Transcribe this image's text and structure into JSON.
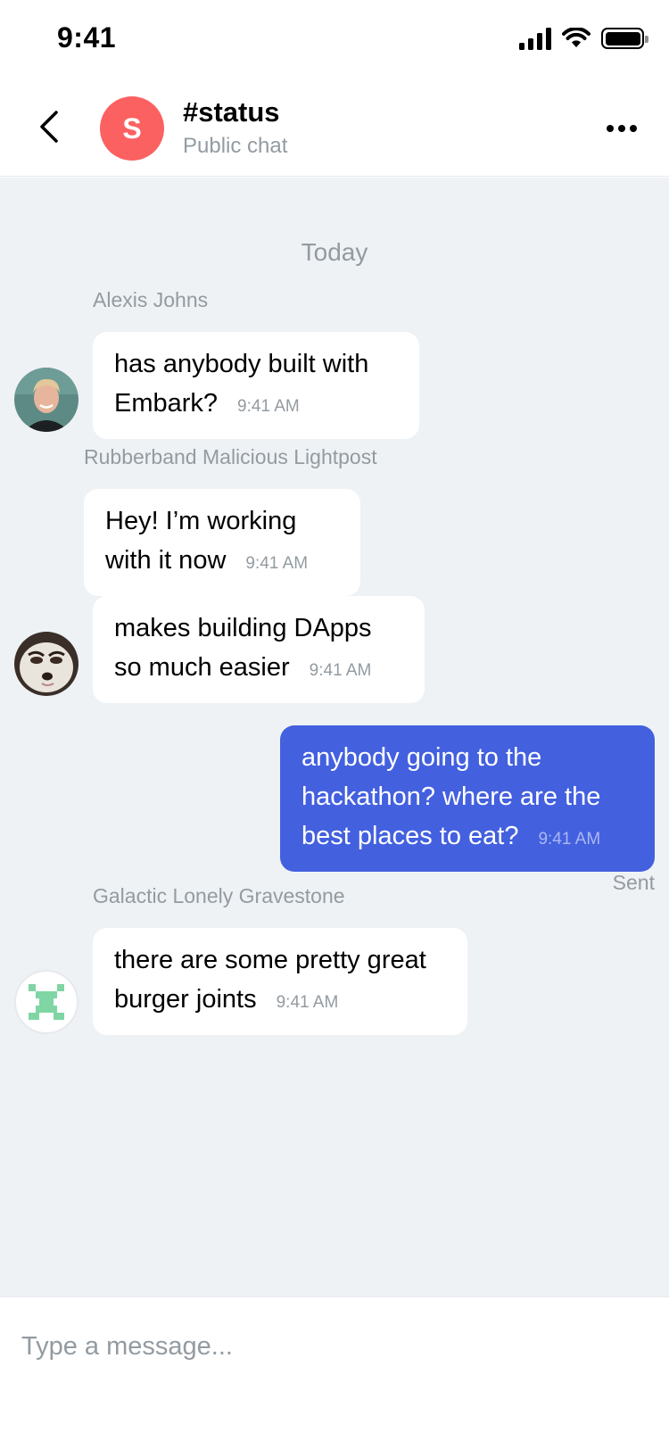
{
  "status_bar": {
    "time": "9:41"
  },
  "header": {
    "avatar_letter": "S",
    "title": "#status",
    "subtitle": "Public chat",
    "avatar_color": "#fc6161"
  },
  "chat": {
    "date_divider": "Today",
    "groups": [
      {
        "sender": "Alexis Johns",
        "messages": [
          {
            "text": "has anybody built with Embark?",
            "time": "9:41 AM"
          }
        ]
      },
      {
        "sender": "Rubberband Malicious Lightpost",
        "messages": [
          {
            "text": "Hey! I’m working with it now",
            "time": "9:41 AM"
          },
          {
            "text": "makes building DApps so much easier",
            "time": "9:41 AM"
          }
        ]
      },
      {
        "sender": "",
        "outgoing": true,
        "messages": [
          {
            "text": "anybody going to the hackathon? where are the best places to eat?",
            "time": "9:41 AM"
          }
        ],
        "status": "Sent"
      },
      {
        "sender": "Galactic Lonely Gravestone",
        "messages": [
          {
            "text": " there are some pretty great burger joints",
            "time": "9:41 AM"
          }
        ]
      }
    ]
  },
  "composer": {
    "placeholder": "Type a message..."
  },
  "colors": {
    "accent": "#4360df",
    "background": "#eef2f5",
    "secondary_text": "#939ba1"
  }
}
